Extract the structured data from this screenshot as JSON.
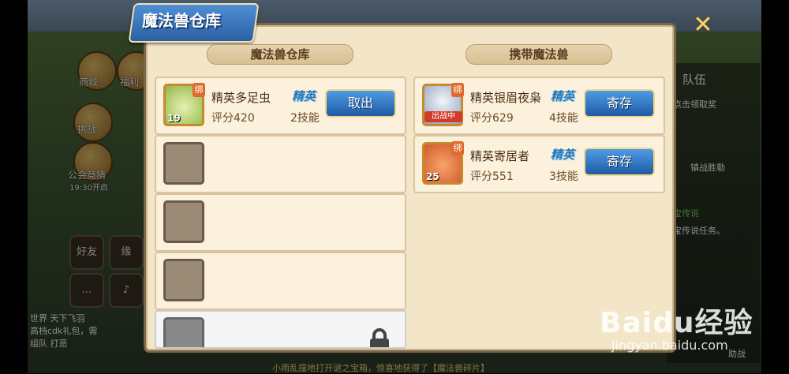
{
  "window": {
    "title": "魔法兽仓库",
    "close_icon": "close-icon"
  },
  "warehouse": {
    "header": "魔法兽仓库",
    "pets": [
      {
        "name": "精英多足虫",
        "level": "19",
        "bind_tag": "绑",
        "score_label": "评分420",
        "rank": "精英",
        "skills": "2技能",
        "action": "取出"
      }
    ],
    "empty_slots": 3,
    "locked_slot": {
      "lock_icon": "lock-icon"
    }
  },
  "carried": {
    "header": "携带魔法兽",
    "pets": [
      {
        "name": "精英银眉夜枭",
        "bind_tag": "绑",
        "status_tag": "出战中",
        "score_label": "评分629",
        "rank": "精英",
        "skills": "4技能",
        "action": "寄存"
      },
      {
        "name": "精英寄居者",
        "level": "25",
        "bind_tag": "绑",
        "score_label": "评分551",
        "rank": "精英",
        "skills": "3技能",
        "action": "寄存"
      }
    ]
  },
  "background": {
    "left_icons": [
      {
        "label": "商城"
      },
      {
        "label": "福利"
      },
      {
        "label": "挑战"
      },
      {
        "label": "公会竞猜"
      },
      {
        "label": "19:30开启"
      }
    ],
    "social_buttons": [
      {
        "label": "好友"
      },
      {
        "label": "缘"
      }
    ],
    "chat_lines": [
      "世界 天下飞羽",
      "高档cdk礼包，需",
      "组队 打恶"
    ],
    "right_tab": "队伍",
    "right_texts": [
      "点击领取奖",
      "镇战胜勒",
      "宝传说",
      "宝传说任务。",
      "助战"
    ],
    "bottom_message": "小雨乱撞地打开谜之宝箱，惊喜地获得了【魔法兽碎片】",
    "watermark": "Baidu经验",
    "watermark_sub": "jingyan.baidu.com"
  },
  "colors": {
    "panel": "#f3e6c8",
    "button_blue": "#1e5aa6",
    "elite_blue": "#2a7ab8",
    "banner_blue": "#2b5fa3"
  }
}
